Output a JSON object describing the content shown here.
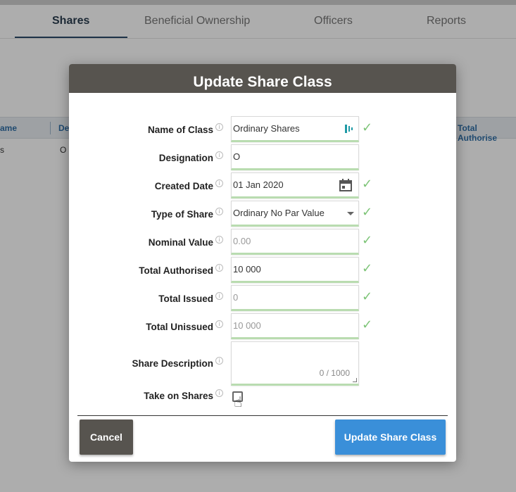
{
  "tabs": [
    {
      "label": "Shares",
      "active": true
    },
    {
      "label": "Beneficial Ownership",
      "active": false
    },
    {
      "label": "Officers",
      "active": false
    },
    {
      "label": "Reports",
      "active": false
    }
  ],
  "background_table": {
    "headers": [
      "ame",
      "De",
      "Total Authorise"
    ],
    "row": [
      "s",
      "O"
    ]
  },
  "modal": {
    "title": "Update Share Class",
    "fields": {
      "name_of_class": {
        "label": "Name of Class",
        "value": "Ordinary Shares"
      },
      "designation": {
        "label": "Designation",
        "value": "O"
      },
      "created_date": {
        "label": "Created Date",
        "value": "01 Jan 2020"
      },
      "type_of_share": {
        "label": "Type of Share",
        "value": "Ordinary No Par Value"
      },
      "nominal_value": {
        "label": "Nominal Value",
        "placeholder": "0.00"
      },
      "total_authorised": {
        "label": "Total Authorised",
        "value": "10 000"
      },
      "total_issued": {
        "label": "Total Issued",
        "placeholder": "0"
      },
      "total_unissued": {
        "label": "Total Unissued",
        "placeholder": "10 000"
      },
      "share_description": {
        "label": "Share Description",
        "counter": "0 / 1000"
      },
      "take_on_shares": {
        "label": "Take on Shares",
        "checked": false
      }
    },
    "buttons": {
      "cancel": "Cancel",
      "update": "Update Share Class"
    }
  },
  "colors": {
    "header_bg": "#57544f",
    "primary": "#3a8fd9",
    "valid_check": "#7dc477"
  }
}
